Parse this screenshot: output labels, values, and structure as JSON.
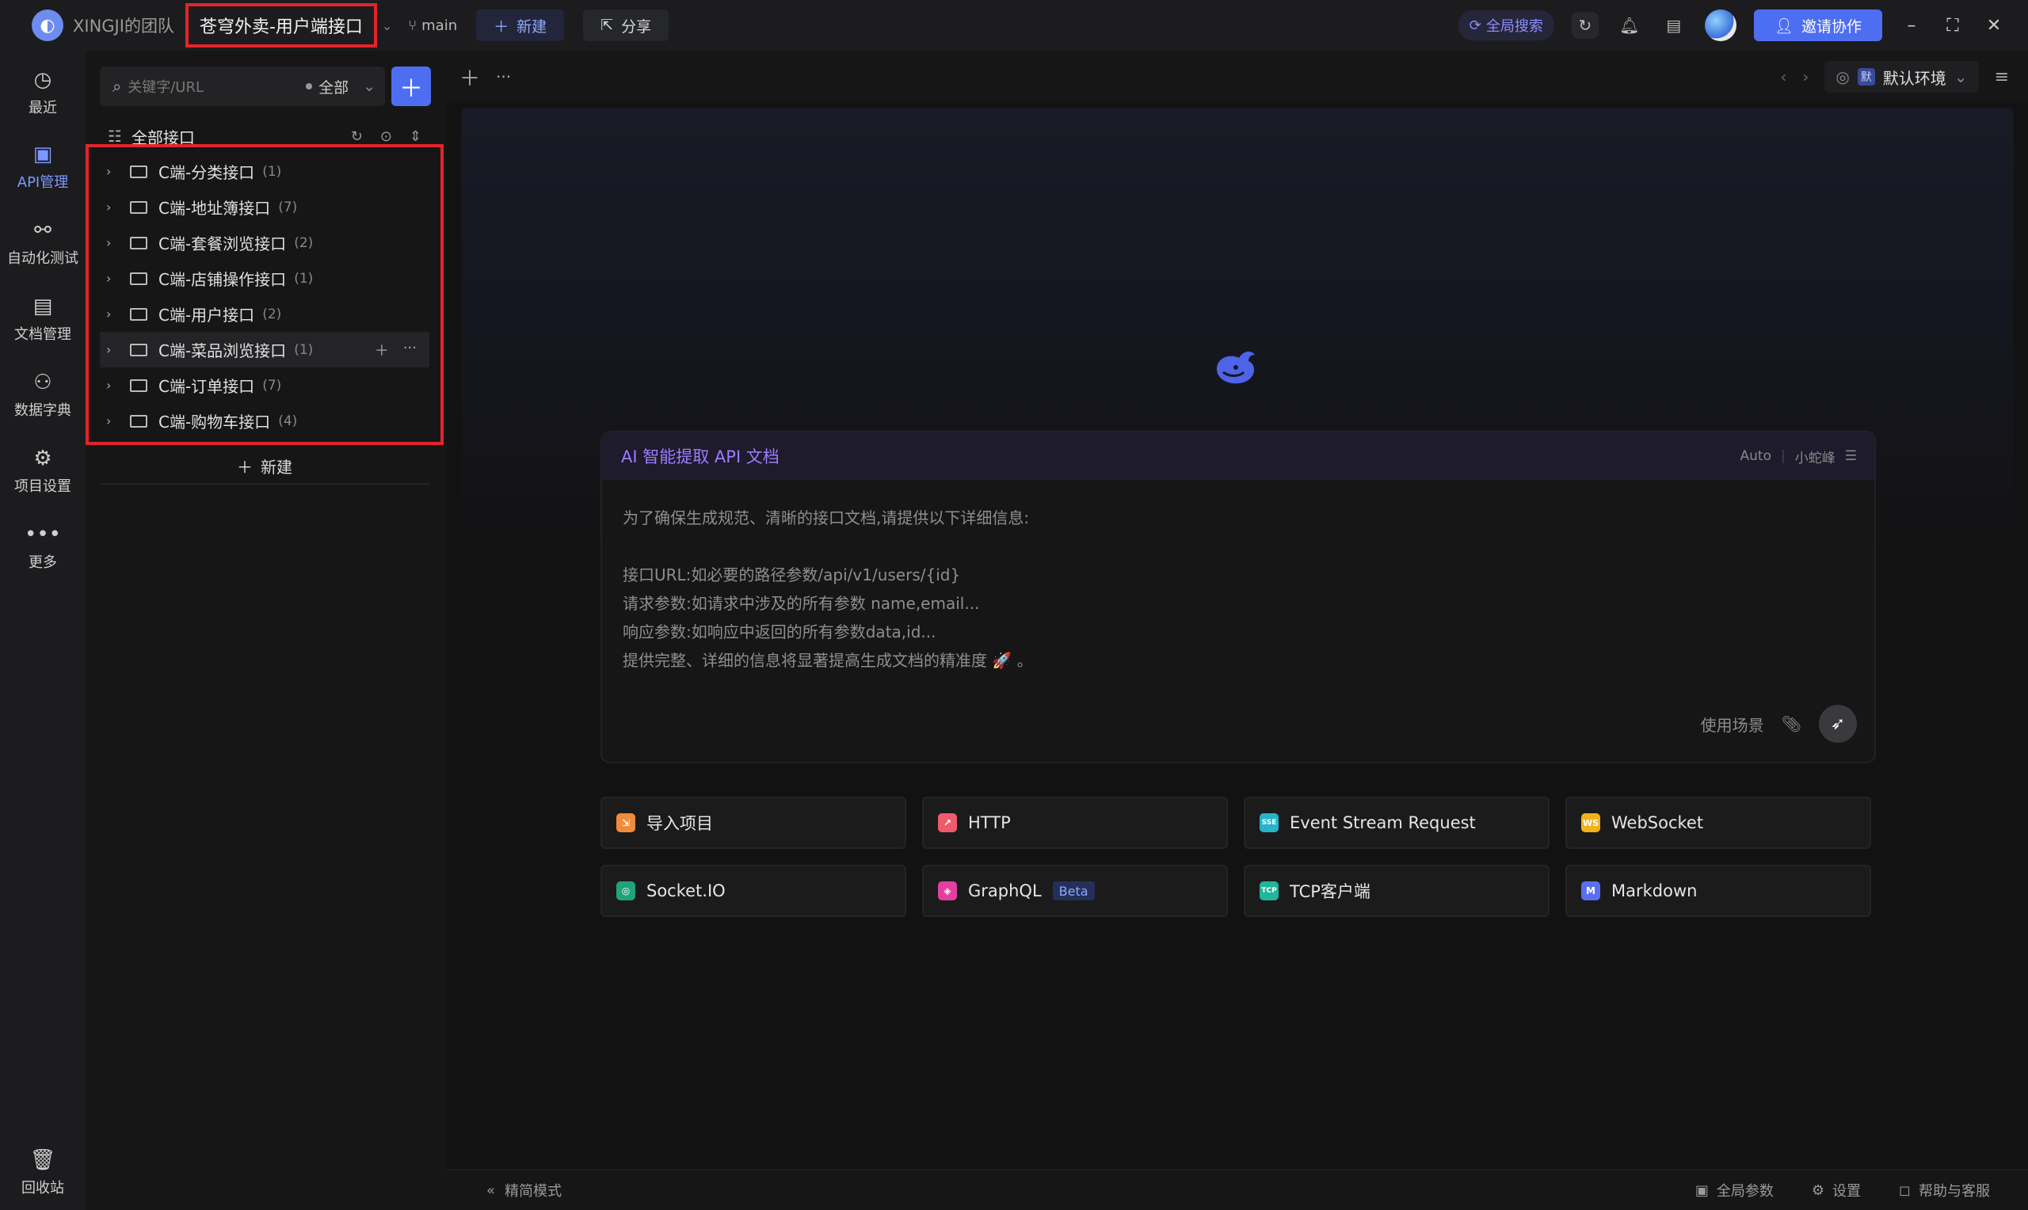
{
  "titlebar": {
    "team": "XINGJI的团队",
    "project": "苍穹外卖-用户端接口",
    "branch": "main",
    "new_label": "新建",
    "share_label": "分享",
    "global_search": "全局搜索",
    "invite_label": "邀请协作"
  },
  "rail": {
    "items": [
      {
        "label": "最近",
        "icon": "history-icon"
      },
      {
        "label": "API管理",
        "icon": "api-icon"
      },
      {
        "label": "自动化测试",
        "icon": "flow-icon"
      },
      {
        "label": "文档管理",
        "icon": "doc-icon"
      },
      {
        "label": "数据字典",
        "icon": "dict-icon"
      },
      {
        "label": "项目设置",
        "icon": "settings-icon"
      },
      {
        "label": "更多",
        "icon": "more-icon"
      }
    ],
    "trash": "回收站"
  },
  "sidebar": {
    "search_placeholder": "关键字/URL",
    "filter": "全部",
    "all_apis": "全部接口",
    "folders": [
      {
        "name": "C端-分类接口",
        "count": "(1)"
      },
      {
        "name": "C端-地址簿接口",
        "count": "(7)"
      },
      {
        "name": "C端-套餐浏览接口",
        "count": "(2)"
      },
      {
        "name": "C端-店铺操作接口",
        "count": "(1)"
      },
      {
        "name": "C端-用户接口",
        "count": "(2)"
      },
      {
        "name": "C端-菜品浏览接口",
        "count": "(1)"
      },
      {
        "name": "C端-订单接口",
        "count": "(7)"
      },
      {
        "name": "C端-购物车接口",
        "count": "(4)"
      }
    ],
    "new_label": "新建"
  },
  "tabstrip": {
    "env": "默认环境",
    "env_badge": "默"
  },
  "ai": {
    "title": "AI 智能提取 API 文档",
    "mode": "Auto",
    "assistant": "小蛇峰",
    "intro": "为了确保生成规范、清晰的接口文档,请提供以下详细信息:",
    "line1": "接口URL:如必要的路径参数/api/v1/users/{id}",
    "line2": "请求参数:如请求中涉及的所有参数 name,email...",
    "line3": "响应参数:如响应中返回的所有参数data,id...",
    "line4": "提供完整、详细的信息将显著提高生成文档的精准度 🚀 。",
    "scene": "使用场景"
  },
  "quick": [
    {
      "label": "导入项目",
      "icon": "import-icon",
      "color": "#f08a3c",
      "glyph": "⇲"
    },
    {
      "label": "HTTP",
      "icon": "http-icon",
      "color": "#ef5b6b",
      "glyph": "↗"
    },
    {
      "label": "Event Stream Request",
      "icon": "sse-icon",
      "color": "#27b3c9",
      "glyph": "SSE"
    },
    {
      "label": "WebSocket",
      "icon": "websocket-icon",
      "color": "#f2b11c",
      "glyph": "WS"
    },
    {
      "label": "Socket.IO",
      "icon": "socketio-icon",
      "color": "#1fa37a",
      "glyph": "◎"
    },
    {
      "label": "GraphQL",
      "icon": "graphql-icon",
      "color": "#e23fa0",
      "glyph": "◈",
      "badge": "Beta"
    },
    {
      "label": "TCP客户端",
      "icon": "tcp-icon",
      "color": "#21b59a",
      "glyph": "TCP"
    },
    {
      "label": "Markdown",
      "icon": "markdown-icon",
      "color": "#5a6ff0",
      "glyph": "M"
    }
  ],
  "footer": {
    "mode": "精简模式",
    "global_params": "全局参数",
    "settings": "设置",
    "help": "帮助与客服"
  },
  "colors": {
    "accent": "#4e6ef2",
    "highlight": "#e3242b",
    "ai_title": "#9d7cff"
  }
}
